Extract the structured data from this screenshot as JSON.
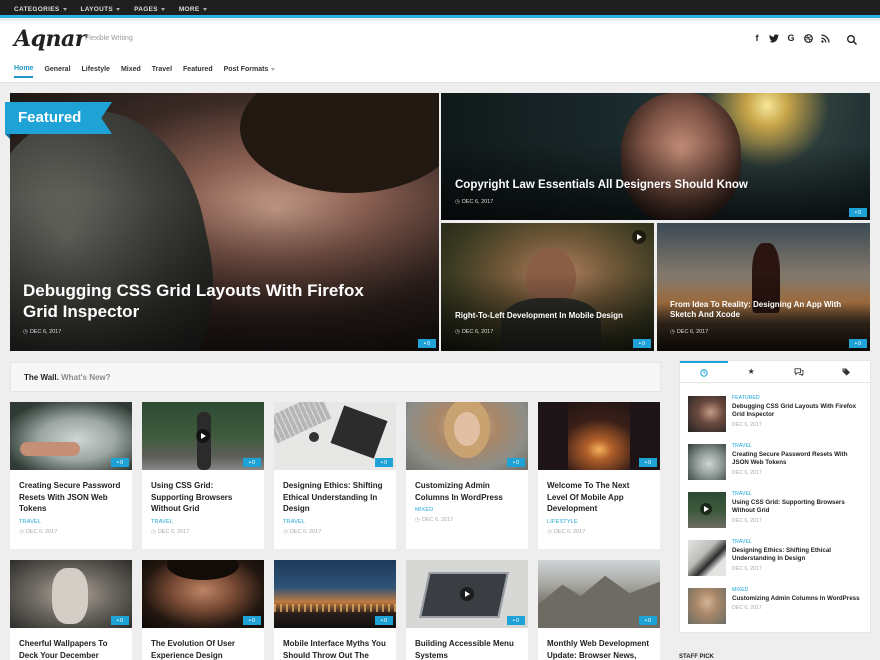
{
  "topbar": {
    "items": [
      {
        "label": "CATEGORIES"
      },
      {
        "label": "LAYOUTS"
      },
      {
        "label": "PAGES"
      },
      {
        "label": "MORE"
      }
    ]
  },
  "header": {
    "logo": "Aqnar",
    "tagline": "Flexible Writing"
  },
  "nav": {
    "items": [
      {
        "label": "Home",
        "active": true
      },
      {
        "label": "General"
      },
      {
        "label": "Lifestyle"
      },
      {
        "label": "Mixed"
      },
      {
        "label": "Travel"
      },
      {
        "label": "Featured"
      },
      {
        "label": "Post Formats"
      }
    ]
  },
  "hero": {
    "flag": "Featured",
    "main": {
      "title": "Debugging CSS Grid Layouts With Firefox Grid Inspector",
      "date": "DEC 6, 2017",
      "comments": "0"
    },
    "top_right": {
      "title": "Copyright Law Essentials All Designers Should Know",
      "date": "DEC 6, 2017",
      "comments": "0"
    },
    "bottom_left": {
      "title": "Right-To-Left Development In Mobile Design",
      "date": "DEC 6, 2017",
      "comments": "0"
    },
    "bottom_right": {
      "title": "From Idea To Reality: Designing An App With Sketch And Xcode",
      "date": "DEC 6, 2017",
      "comments": "0"
    }
  },
  "wall": {
    "title": "The Wall.",
    "subtitle": "What's New?",
    "cards": [
      {
        "title": "Creating Secure Password Resets With JSON Web Tokens",
        "category": "TRAVEL",
        "date": "DEC 6, 2017",
        "comments": "0"
      },
      {
        "title": "Using CSS Grid: Supporting Browsers Without Grid",
        "category": "TRAVEL",
        "date": "DEC 6, 2017",
        "comments": "0"
      },
      {
        "title": "Designing Ethics: Shifting Ethical Understanding In Design",
        "category": "TRAVEL",
        "date": "DEC 6, 2017",
        "comments": "0"
      },
      {
        "title": "Customizing Admin Columns In WordPress",
        "category": "MIXED",
        "date": "DEC 6, 2017",
        "comments": "0"
      },
      {
        "title": "Welcome To The Next Level Of Mobile App Development",
        "category": "LIFESTYLE",
        "date": "DEC 6, 2017",
        "comments": "0"
      },
      {
        "title": "Cheerful Wallpapers To Deck Your December",
        "comments": "0"
      },
      {
        "title": "The Evolution Of User Experience Design",
        "comments": "0"
      },
      {
        "title": "Mobile Interface Myths You Should Throw Out The",
        "comments": "0"
      },
      {
        "title": "Building Accessible Menu Systems",
        "comments": "0"
      },
      {
        "title": "Monthly Web Development Update: Browser News,",
        "comments": "0"
      }
    ]
  },
  "sidebar": {
    "items": [
      {
        "category": "FEATURED",
        "title": "Debugging CSS Grid Layouts With Firefox Grid Inspector",
        "date": "DEC 6, 2017"
      },
      {
        "category": "TRAVEL",
        "title": "Creating Secure Password Resets With JSON Web Tokens",
        "date": "DEC 6, 2017"
      },
      {
        "category": "TRAVEL",
        "title": "Using CSS Grid: Supporting Browsers Without Grid",
        "date": "DEC 6, 2017"
      },
      {
        "category": "TRAVEL",
        "title": "Designing Ethics: Shifting Ethical Understanding In Design",
        "date": "DEC 6, 2017"
      },
      {
        "category": "MIXED",
        "title": "Customizing Admin Columns In WordPress",
        "date": "DEC 6, 2017"
      }
    ],
    "staff_pick": "STAFF PICK"
  },
  "colors": {
    "accent": "#1fa3d6",
    "topbar": "#1f1f1f"
  }
}
